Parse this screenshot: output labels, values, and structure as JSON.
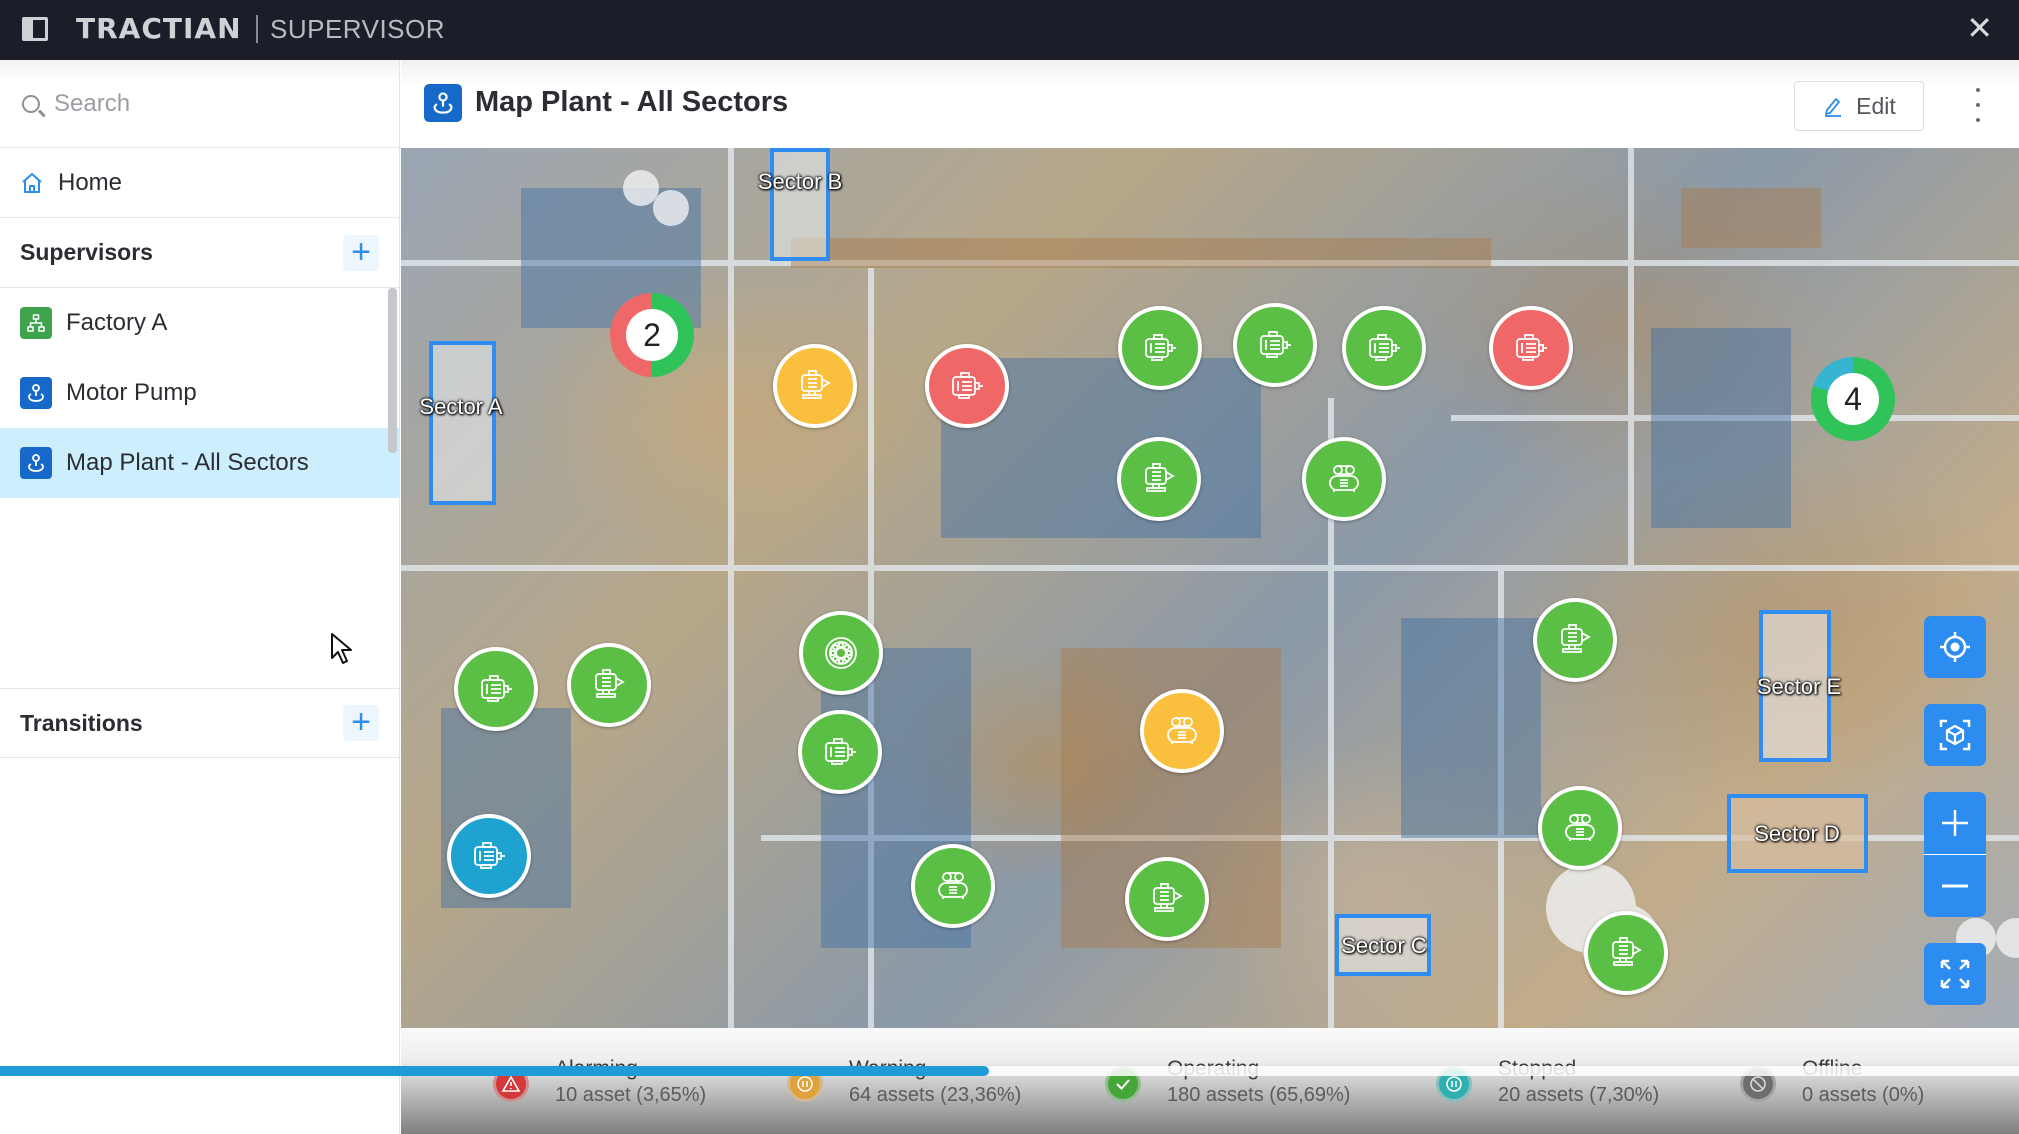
{
  "topbar": {
    "brand": "TRACTIAN",
    "product": "SUPERVISOR",
    "close_label": "✕"
  },
  "sidebar": {
    "search_placeholder": "Search",
    "home_label": "Home",
    "supervisors_title": "Supervisors",
    "supervisors": [
      {
        "label": "Factory A",
        "icon": "hierarchy-icon",
        "color": "#3fa34d"
      },
      {
        "label": "Motor Pump",
        "icon": "map-pin-icon",
        "color": "#1669c9"
      },
      {
        "label": "Map Plant - All Sectors",
        "icon": "map-pin-icon",
        "color": "#1669c9",
        "active": true
      }
    ],
    "transitions_title": "Transitions",
    "add_label": "+"
  },
  "header": {
    "title": "Map Plant - All Sectors",
    "edit_label": "Edit"
  },
  "map": {
    "sectors": [
      {
        "label": "Sector A"
      },
      {
        "label": "Sector B"
      },
      {
        "label": "Sector C"
      },
      {
        "label": "Sector D"
      },
      {
        "label": "Sector E"
      }
    ],
    "clusters": [
      {
        "count": "2",
        "segments": [
          {
            "status": "alarming",
            "share": 0.5
          },
          {
            "status": "operating",
            "share": 0.5
          }
        ]
      },
      {
        "count": "4",
        "segments": [
          {
            "status": "operating",
            "share": 0.8
          },
          {
            "status": "stopped",
            "share": 0.2
          }
        ]
      }
    ],
    "assets": [
      {
        "type": "motor-pump",
        "status": "warning"
      },
      {
        "type": "motor",
        "status": "alarming"
      },
      {
        "type": "motor",
        "status": "operating"
      },
      {
        "type": "motor",
        "status": "operating"
      },
      {
        "type": "motor",
        "status": "operating"
      },
      {
        "type": "motor",
        "status": "alarming"
      },
      {
        "type": "motor-pump",
        "status": "operating"
      },
      {
        "type": "compressor",
        "status": "operating"
      },
      {
        "type": "motor",
        "status": "operating"
      },
      {
        "type": "motor-pump",
        "status": "operating"
      },
      {
        "type": "motor",
        "status": "stopped"
      },
      {
        "type": "bearing",
        "status": "operating"
      },
      {
        "type": "motor",
        "status": "operating"
      },
      {
        "type": "compressor",
        "status": "warning"
      },
      {
        "type": "compressor",
        "status": "operating"
      },
      {
        "type": "motor-pump",
        "status": "operating"
      },
      {
        "type": "motor-pump",
        "status": "operating"
      },
      {
        "type": "compressor",
        "status": "operating"
      },
      {
        "type": "motor-pump",
        "status": "operating"
      }
    ],
    "controls": [
      "locate",
      "3d-view",
      "zoom-in",
      "zoom-out",
      "fullscreen"
    ]
  },
  "colors": {
    "alarming": "#f06767",
    "warning": "#fbbf3e",
    "operating": "#5bbf45",
    "stopped": "#1ea2cf",
    "offline": "#6b6b6b",
    "cluster_operating": "#30c35a",
    "cluster_stopped": "#35b5d0",
    "accent": "#2d8cf0"
  },
  "status_bar": [
    {
      "label": "Alarming",
      "value": "10 asset (3,65%)",
      "status": "alarming",
      "color": "#d43a3a"
    },
    {
      "label": "Warning",
      "value": "64 assets (23,36%)",
      "status": "warning",
      "color": "#e0a23a"
    },
    {
      "label": "Operating",
      "value": "180 assets (65,69%)",
      "status": "operating",
      "color": "#45a73a"
    },
    {
      "label": "Stopped",
      "value": "20 assets (7,30%)",
      "status": "stopped",
      "color": "#2fb0ae"
    },
    {
      "label": "Offline",
      "value": "0 assets (0%)",
      "status": "offline",
      "color": "#6e6e6e"
    }
  ],
  "video_progress": 0.49
}
